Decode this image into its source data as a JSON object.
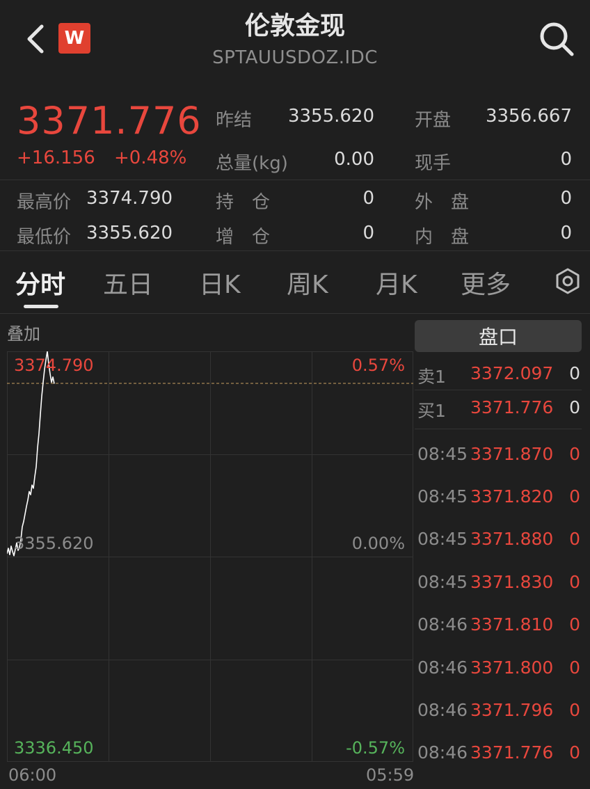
{
  "header": {
    "title": "伦敦金现",
    "symbol": "SPTAUUSDOZ.IDC",
    "logo_letter": "W",
    "logo_color": "#e0402f"
  },
  "quote": {
    "price": "3371.776",
    "change": "+16.156",
    "change_pct": "+0.48%",
    "fields": [
      {
        "label": "昨结",
        "value": "3355.620"
      },
      {
        "label": "开盘",
        "value": "3356.667"
      },
      {
        "label": "总量(kg)",
        "value": "0.00"
      },
      {
        "label": "现手",
        "value": "0"
      },
      {
        "label": "最高价",
        "value": "3374.790"
      },
      {
        "label": "持　仓",
        "value": "0"
      },
      {
        "label": "外　盘",
        "value": "0"
      },
      {
        "label": "最低价",
        "value": "3355.620"
      },
      {
        "label": "增　仓",
        "value": "0"
      },
      {
        "label": "内　盘",
        "value": "0"
      }
    ]
  },
  "tabs": [
    "分时",
    "五日",
    "日K",
    "周K",
    "月K",
    "更多"
  ],
  "overlay_label": "叠加",
  "chart_data": {
    "type": "line",
    "y_left_labels": {
      "top": "3374.790",
      "mid": "3355.620",
      "bottom": "3336.450"
    },
    "y_right_labels": {
      "top": "0.57%",
      "mid": "0.00%",
      "bottom": "-0.57%"
    },
    "x_labels": {
      "start": "06:00",
      "end": "05:59"
    },
    "ylim": [
      3336.45,
      3374.79
    ],
    "reference": 3355.62,
    "high_line": 3374.79,
    "values": [
      3355.9,
      3356.4,
      3355.8,
      3356.6,
      3356.1,
      3355.7,
      3356.3,
      3356.9,
      3356.2,
      3356.5,
      3357.2,
      3358.4,
      3358.9,
      3359.6,
      3360.3,
      3360.9,
      3361.7,
      3361.4,
      3362.3,
      3362.0,
      3363.1,
      3364.0,
      3365.8,
      3367.1,
      3368.9,
      3370.6,
      3371.9,
      3373.1,
      3374.0,
      3374.79,
      3373.6,
      3372.7,
      3371.9,
      3372.4,
      3371.776
    ],
    "colors": {
      "up": "#e8473d",
      "down": "#56b35b",
      "line": "#ffffff",
      "grid": "#333333",
      "ref": "#c8a060"
    }
  },
  "orderbook": {
    "title": "盘口",
    "ask": {
      "label": "卖1",
      "price": "3372.097",
      "qty": "0"
    },
    "bid": {
      "label": "买1",
      "price": "3371.776",
      "qty": "0"
    }
  },
  "trades": [
    {
      "time": "08:45",
      "price": "3371.870",
      "qty": "0"
    },
    {
      "time": "08:45",
      "price": "3371.820",
      "qty": "0"
    },
    {
      "time": "08:45",
      "price": "3371.880",
      "qty": "0"
    },
    {
      "time": "08:45",
      "price": "3371.830",
      "qty": "0"
    },
    {
      "time": "08:46",
      "price": "3371.810",
      "qty": "0"
    },
    {
      "time": "08:46",
      "price": "3371.800",
      "qty": "0"
    },
    {
      "time": "08:46",
      "price": "3371.796",
      "qty": "0"
    },
    {
      "time": "08:46",
      "price": "3371.776",
      "qty": "0"
    }
  ]
}
